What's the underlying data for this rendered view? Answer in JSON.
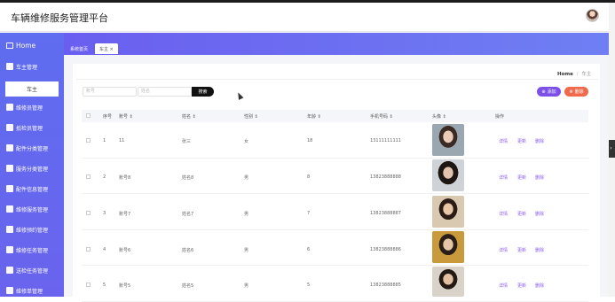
{
  "app": {
    "title": "车辆维修服务管理平台"
  },
  "sidebar": {
    "home": "Home",
    "group": "车主管理",
    "sub_active": "车主",
    "items": [
      "维修员管理",
      "抵检员管理",
      "配件分类管理",
      "服务分类管理",
      "配件信息管理",
      "维修服务管理",
      "维修预约管理",
      "维修任务管理",
      "送检任务管理",
      "维修单管理"
    ]
  },
  "tabs": [
    {
      "label": "系统首页"
    },
    {
      "label": "车主 ×"
    }
  ],
  "breadcrumb": {
    "home": "Home",
    "sep": "/",
    "current": "车主"
  },
  "search": {
    "placeholder1": "账号",
    "placeholder2": "姓名",
    "button": "搜索"
  },
  "actions": {
    "add": "添加",
    "delete": "删除"
  },
  "table": {
    "headers": [
      "",
      "序号",
      "账号 ⇕",
      "姓名 ⇕",
      "性别 ⇕",
      "年龄 ⇕",
      "手机号码 ⇕",
      "头像 ⇕",
      "操作"
    ],
    "rows": [
      {
        "no": "1",
        "account": "11",
        "name": "张三",
        "gender": "女",
        "age": "18",
        "phone": "13111111111"
      },
      {
        "no": "2",
        "account": "账号8",
        "name": "姓名8",
        "gender": "男",
        "age": "8",
        "phone": "13823888888"
      },
      {
        "no": "3",
        "account": "账号7",
        "name": "姓名7",
        "gender": "男",
        "age": "7",
        "phone": "13823888887"
      },
      {
        "no": "4",
        "account": "账号6",
        "name": "姓名6",
        "gender": "男",
        "age": "6",
        "phone": "13823888886"
      },
      {
        "no": "5",
        "account": "账号5",
        "name": "姓名5",
        "gender": "男",
        "age": "5",
        "phone": "13823888885"
      }
    ],
    "ops": {
      "detail": "详情",
      "edit": "更新",
      "delete": "删除"
    }
  },
  "colors": {
    "sidebar": "#5f6df0",
    "accent": "#7b4fe8",
    "danger": "#f0694a",
    "link": "#8a5cf0"
  }
}
